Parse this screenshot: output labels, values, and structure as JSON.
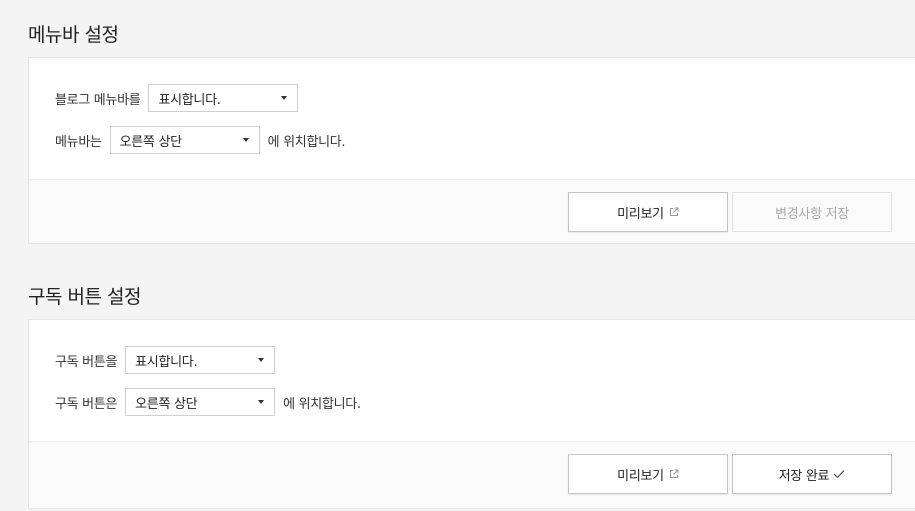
{
  "menubar": {
    "title": "메뉴바 설정",
    "row1": {
      "label": "블로그 메뉴바를",
      "select_value": "표시합니다."
    },
    "row2": {
      "label": "메뉴바는",
      "select_value": "오른쪽 상단",
      "suffix": "에 위치합니다."
    },
    "preview_label": "미리보기",
    "save_label": "변경사항 저장"
  },
  "subscribe": {
    "title": "구독 버튼 설정",
    "row1": {
      "label": "구독 버튼을",
      "select_value": "표시합니다."
    },
    "row2": {
      "label": "구독 버튼은",
      "select_value": "오른쪽 상단",
      "suffix": "에 위치합니다."
    },
    "preview_label": "미리보기",
    "save_label": "저장 완료"
  },
  "icons": {
    "external": "external-link-icon",
    "check": "check-icon",
    "caret": "caret-down-icon"
  },
  "colors": {
    "page_bg": "#f4f4f4",
    "card_bg": "#ffffff",
    "footer_bg": "#fafafa",
    "border": "#e4e4e4",
    "disabled_text": "#aaaaaa"
  }
}
